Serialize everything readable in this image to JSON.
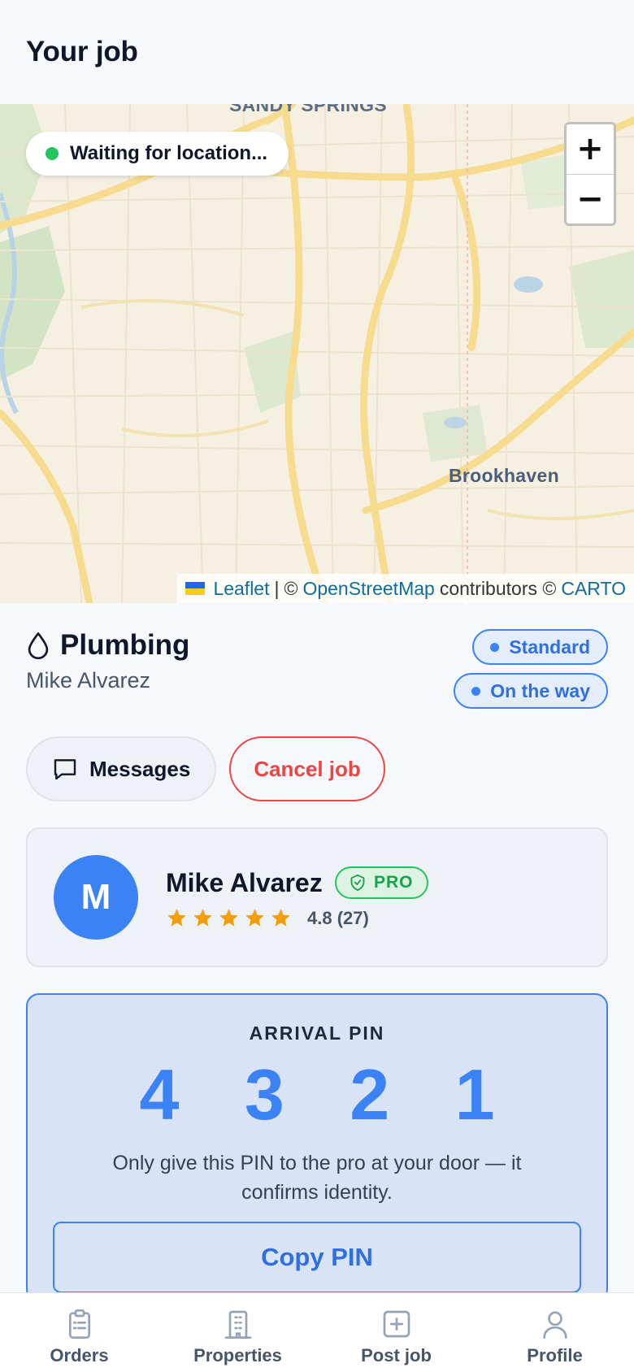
{
  "header": {
    "title": "Your job"
  },
  "map": {
    "location_status": "Waiting for location...",
    "zoom_in": "+",
    "zoom_out": "−",
    "place_labels": {
      "top": "SANDY SPRINGS",
      "east": "Brookhaven"
    },
    "attribution": {
      "leaflet": "Leaflet",
      "sep": "|",
      "copy1": "©",
      "osm": "OpenStreetMap",
      "contributors": "contributors ©",
      "carto": "CARTO"
    }
  },
  "job": {
    "category": "Plumbing",
    "icon": "droplet-icon",
    "customer": "Mike Alvarez",
    "badges": [
      "Standard",
      "On the way"
    ]
  },
  "actions": {
    "messages": "Messages",
    "cancel": "Cancel job"
  },
  "pro": {
    "initial": "M",
    "name": "Mike Alvarez",
    "tag": "PRO",
    "stars": 5,
    "rating_text": "4.8 (27)"
  },
  "pin": {
    "label": "ARRIVAL PIN",
    "value": "4321",
    "display": "4 3 2 1",
    "note": "Only give this PIN to the pro at your door — it confirms identity.",
    "copy_label": "Copy PIN"
  },
  "nav": {
    "items": [
      {
        "label": "Orders",
        "icon": "clipboard-icon"
      },
      {
        "label": "Properties",
        "icon": "building-icon"
      },
      {
        "label": "Post job",
        "icon": "plus-square-icon"
      },
      {
        "label": "Profile",
        "icon": "person-icon"
      }
    ]
  },
  "colors": {
    "accent": "#3b82f6",
    "danger": "#ef4444",
    "success": "#22c55e",
    "star": "#f59e0b"
  }
}
